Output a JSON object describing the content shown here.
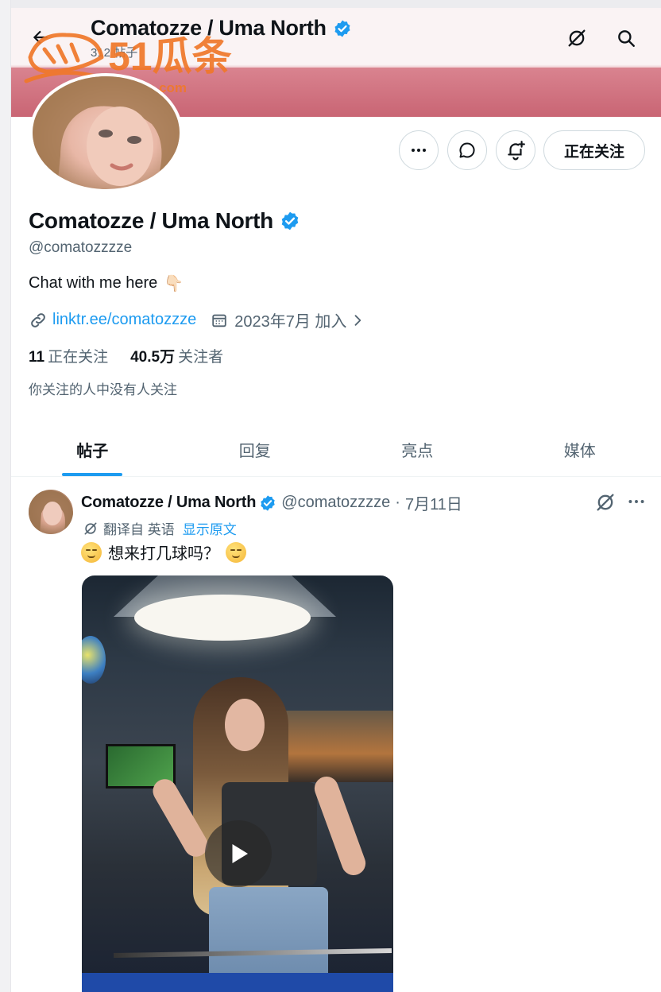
{
  "header": {
    "back_icon": "arrow-left-icon",
    "title": "Comatozze / Uma North",
    "post_count": "312 帖子",
    "grok_icon": "grok-icon",
    "search_icon": "search-icon"
  },
  "watermark": {
    "brand": "51瓜条",
    "url": "51guatiao.com"
  },
  "profile": {
    "name": "Comatozze / Uma North",
    "verified": true,
    "handle": "@comatozzzze",
    "bio": "Chat with me here",
    "bio_emoji": "👇🏻",
    "link": "linktr.ee/comatozzze",
    "joined": "2023年7月 加入",
    "following_count": "11",
    "following_label": "正在关注",
    "followers_count": "40.5万",
    "followers_label": "关注者",
    "followed_by_note": "你关注的人中没有人关注"
  },
  "actions": {
    "more_icon": "more-icon",
    "message_icon": "message-icon",
    "notify_icon": "bell-plus-icon",
    "follow_label": "正在关注"
  },
  "tabs": [
    {
      "label": "帖子",
      "active": true
    },
    {
      "label": "回复",
      "active": false
    },
    {
      "label": "亮点",
      "active": false
    },
    {
      "label": "媒体",
      "active": false
    }
  ],
  "post": {
    "author": "Comatozze / Uma North",
    "handle": "@comatozzzze",
    "separator": "·",
    "date": "7月11日",
    "translated_from": "翻译自 英语",
    "show_original": "显示原文",
    "text": "想来打几球吗？",
    "media_type": "video"
  },
  "colors": {
    "accent": "#1d9bf0",
    "text": "#0f1419",
    "muted": "#536471",
    "banner": "#c96574"
  }
}
